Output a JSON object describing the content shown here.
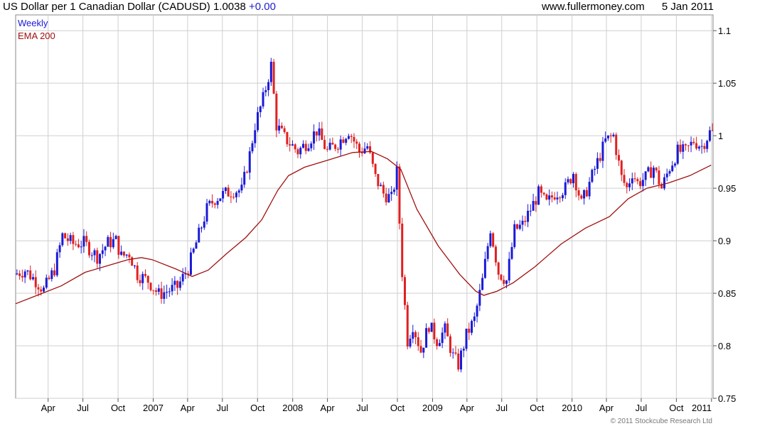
{
  "header": {
    "title": "US Dollar per 1 Canadian Dollar (CADUSD)",
    "last": "1.0038",
    "change": "+0.00",
    "site": "www.fullermoney.com",
    "date": "5 Jan 2011"
  },
  "footer": {
    "copyright": "© 2011 Stockcube Research Ltd"
  },
  "colors": {
    "up": "#1a1ad8",
    "down": "#e02020",
    "ema": "#a01010",
    "legend_weekly": "#1a1ad8",
    "legend_ema": "#a01010",
    "grid": "#cfcfcf"
  },
  "chart_data": {
    "type": "candlestick",
    "interval": "Weekly",
    "legend": [
      "Weekly",
      "EMA 200"
    ],
    "ylim": [
      0.75,
      1.115
    ],
    "y_ticks": [
      0.75,
      0.8,
      0.85,
      0.9,
      0.95,
      1,
      1.05,
      1.1
    ],
    "y_tick_labels": [
      "0.75",
      "0.8",
      "0.85",
      "0.9",
      "0.95",
      "1",
      "1.05",
      "1.1"
    ],
    "x_ticks": [
      "Apr",
      "Jul",
      "Oct",
      "2007",
      "Apr",
      "Jul",
      "Oct",
      "2008",
      "Apr",
      "Jul",
      "Oct",
      "2009",
      "Apr",
      "Jul",
      "Oct",
      "2010",
      "Apr",
      "Jul",
      "Oct",
      "2011"
    ],
    "xlim": [
      "2006-01-06",
      "2011-01-05"
    ],
    "grid": true,
    "legend_position": "top-left",
    "price_path": [
      [
        "2006-01-06",
        0.868
      ],
      [
        "2006-02-03",
        0.872
      ],
      [
        "2006-03-03",
        0.862
      ],
      [
        "2006-03-24",
        0.853
      ],
      [
        "2006-04-21",
        0.873
      ],
      [
        "2006-05-12",
        0.905
      ],
      [
        "2006-06-09",
        0.897
      ],
      [
        "2006-07-07",
        0.898
      ],
      [
        "2006-08-11",
        0.885
      ],
      [
        "2006-09-08",
        0.898
      ],
      [
        "2006-09-29",
        0.9
      ],
      [
        "2006-10-13",
        0.885
      ],
      [
        "2006-11-03",
        0.888
      ],
      [
        "2006-11-24",
        0.868
      ],
      [
        "2006-12-22",
        0.862
      ],
      [
        "2007-01-19",
        0.849
      ],
      [
        "2007-02-09",
        0.852
      ],
      [
        "2007-03-09",
        0.856
      ],
      [
        "2007-04-06",
        0.874
      ],
      [
        "2007-04-27",
        0.898
      ],
      [
        "2007-05-25",
        0.93
      ],
      [
        "2007-06-15",
        0.94
      ],
      [
        "2007-07-06",
        0.944
      ],
      [
        "2007-08-03",
        0.948
      ],
      [
        "2007-08-24",
        0.948
      ],
      [
        "2007-09-14",
        0.982
      ],
      [
        "2007-09-28",
        1.01
      ],
      [
        "2007-10-19",
        1.035
      ],
      [
        "2007-11-09",
        1.067
      ],
      [
        "2007-11-23",
        1.01
      ],
      [
        "2007-12-14",
        0.998
      ],
      [
        "2008-01-18",
        0.985
      ],
      [
        "2008-02-15",
        0.995
      ],
      [
        "2008-03-07",
        1.005
      ],
      [
        "2008-04-04",
        0.985
      ],
      [
        "2008-05-02",
        0.993
      ],
      [
        "2008-05-30",
        1.005
      ],
      [
        "2008-06-27",
        0.985
      ],
      [
        "2008-07-18",
        0.99
      ],
      [
        "2008-08-08",
        0.96
      ],
      [
        "2008-08-29",
        0.945
      ],
      [
        "2008-09-19",
        0.94
      ],
      [
        "2008-10-03",
        0.965
      ],
      [
        "2008-10-17",
        0.87
      ],
      [
        "2008-10-31",
        0.805
      ],
      [
        "2008-11-14",
        0.82
      ],
      [
        "2008-12-05",
        0.795
      ],
      [
        "2008-12-26",
        0.82
      ],
      [
        "2009-01-16",
        0.805
      ],
      [
        "2009-02-06",
        0.815
      ],
      [
        "2009-02-27",
        0.79
      ],
      [
        "2009-03-13",
        0.782
      ],
      [
        "2009-04-03",
        0.81
      ],
      [
        "2009-04-24",
        0.825
      ],
      [
        "2009-05-15",
        0.862
      ],
      [
        "2009-06-05",
        0.912
      ],
      [
        "2009-06-26",
        0.87
      ],
      [
        "2009-07-17",
        0.862
      ],
      [
        "2009-08-07",
        0.91
      ],
      [
        "2009-08-28",
        0.915
      ],
      [
        "2009-09-18",
        0.93
      ],
      [
        "2009-10-09",
        0.945
      ],
      [
        "2009-10-30",
        0.935
      ],
      [
        "2009-11-20",
        0.945
      ],
      [
        "2009-12-18",
        0.95
      ],
      [
        "2010-01-08",
        0.965
      ],
      [
        "2010-01-29",
        0.935
      ],
      [
        "2010-02-19",
        0.955
      ],
      [
        "2010-03-12",
        0.975
      ],
      [
        "2010-04-02",
        0.995
      ],
      [
        "2010-04-23",
        1.0
      ],
      [
        "2010-05-14",
        0.96
      ],
      [
        "2010-05-28",
        0.95
      ],
      [
        "2010-06-11",
        0.965
      ],
      [
        "2010-06-25",
        0.955
      ],
      [
        "2010-07-16",
        0.96
      ],
      [
        "2010-08-06",
        0.97
      ],
      [
        "2010-08-27",
        0.95
      ],
      [
        "2010-09-17",
        0.97
      ],
      [
        "2010-10-08",
        0.985
      ],
      [
        "2010-10-29",
        0.985
      ],
      [
        "2010-11-19",
        0.995
      ],
      [
        "2010-12-10",
        0.99
      ],
      [
        "2010-12-31",
        1.003
      ]
    ],
    "ema200_path": [
      [
        "2006-01-06",
        0.84
      ],
      [
        "2006-03-03",
        0.848
      ],
      [
        "2006-05-05",
        0.857
      ],
      [
        "2006-07-07",
        0.87
      ],
      [
        "2006-09-01",
        0.876
      ],
      [
        "2006-10-27",
        0.882
      ],
      [
        "2006-12-01",
        0.884
      ],
      [
        "2006-12-29",
        0.882
      ],
      [
        "2007-03-02",
        0.873
      ],
      [
        "2007-04-13",
        0.866
      ],
      [
        "2007-05-25",
        0.872
      ],
      [
        "2007-07-13",
        0.888
      ],
      [
        "2007-08-31",
        0.903
      ],
      [
        "2007-10-12",
        0.92
      ],
      [
        "2007-11-23",
        0.948
      ],
      [
        "2007-12-21",
        0.962
      ],
      [
        "2008-02-01",
        0.97
      ],
      [
        "2008-04-04",
        0.977
      ],
      [
        "2008-06-06",
        0.984
      ],
      [
        "2008-07-25",
        0.985
      ],
      [
        "2008-09-05",
        0.978
      ],
      [
        "2008-10-10",
        0.968
      ],
      [
        "2008-11-21",
        0.93
      ],
      [
        "2009-01-16",
        0.895
      ],
      [
        "2009-03-13",
        0.868
      ],
      [
        "2009-04-24",
        0.852
      ],
      [
        "2009-05-15",
        0.848
      ],
      [
        "2009-06-19",
        0.852
      ],
      [
        "2009-07-31",
        0.86
      ],
      [
        "2009-09-25",
        0.875
      ],
      [
        "2009-12-04",
        0.897
      ],
      [
        "2010-02-05",
        0.912
      ],
      [
        "2010-04-09",
        0.923
      ],
      [
        "2010-05-28",
        0.94
      ],
      [
        "2010-07-16",
        0.95
      ],
      [
        "2010-09-10",
        0.955
      ],
      [
        "2010-11-05",
        0.962
      ],
      [
        "2010-12-31",
        0.972
      ]
    ]
  }
}
